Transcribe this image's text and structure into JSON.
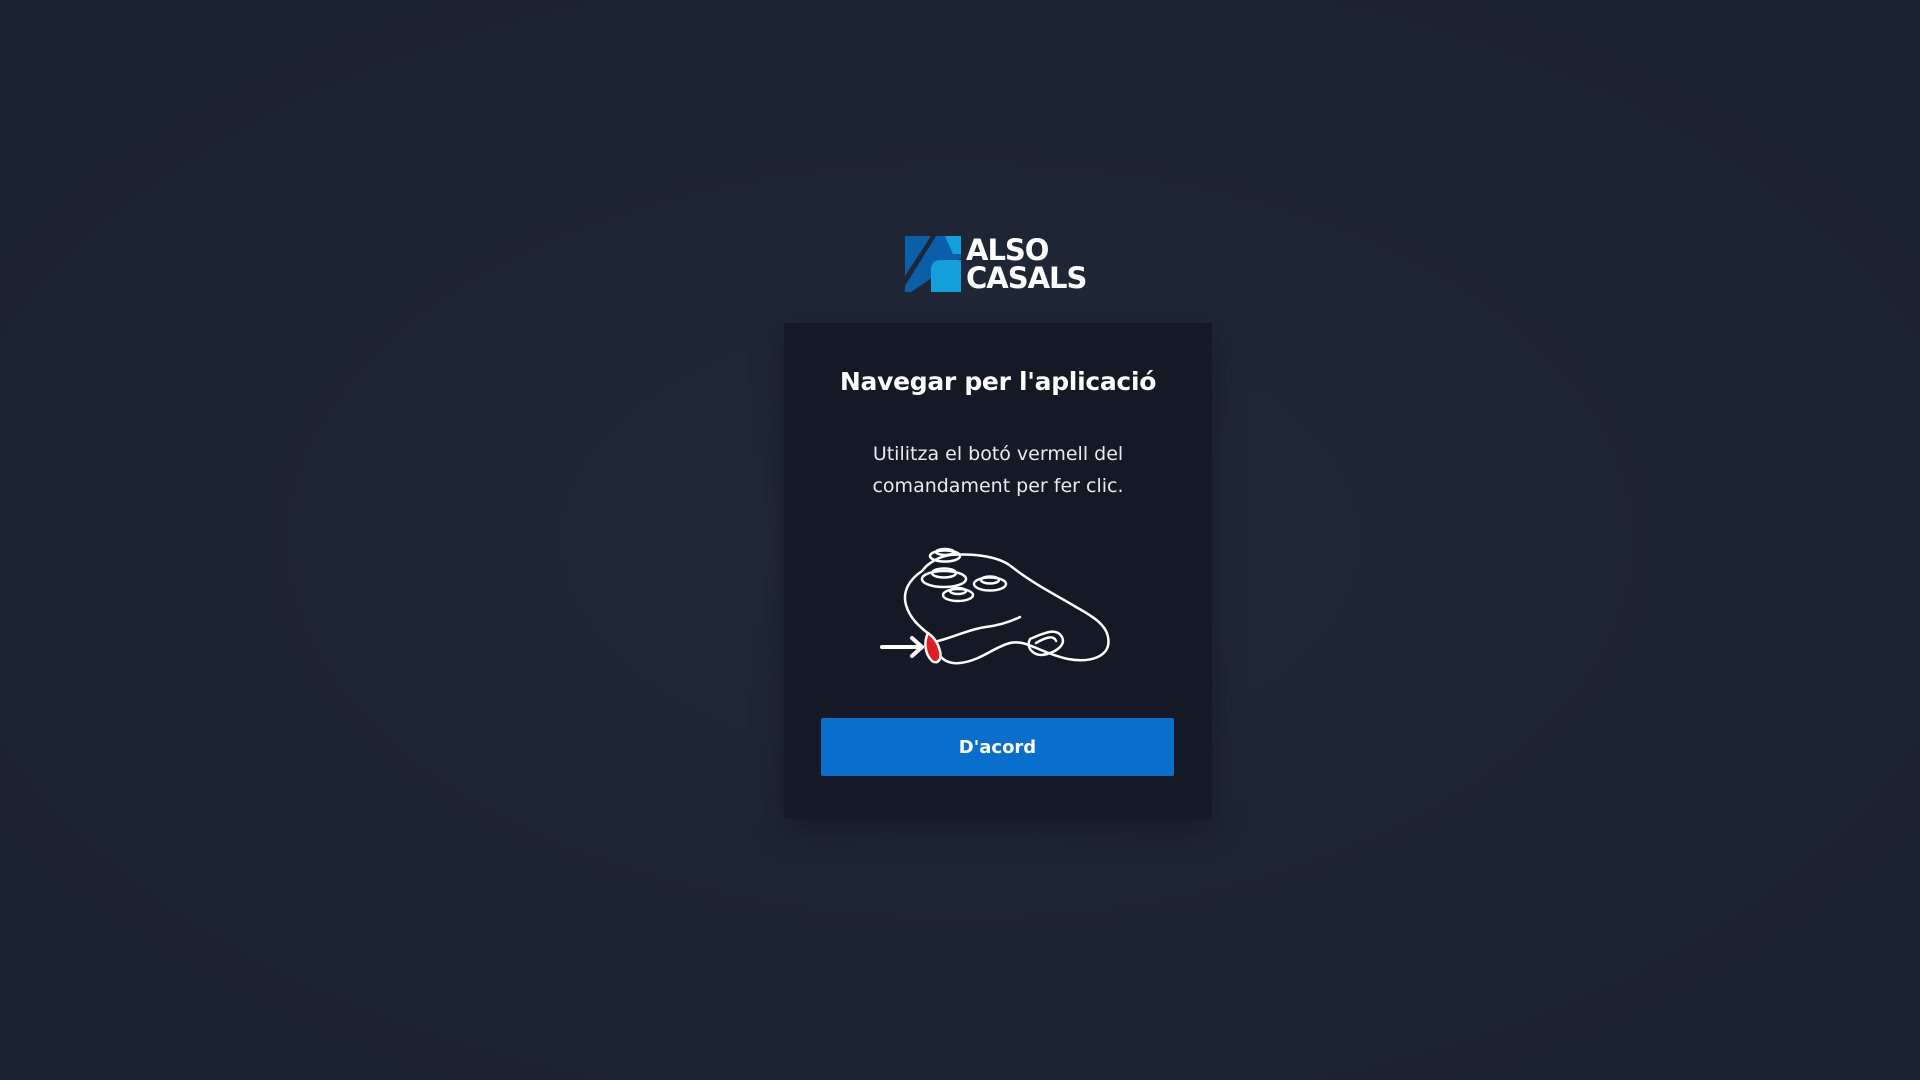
{
  "brand": {
    "line1": "ALSO",
    "line2": "CASALS",
    "colors": {
      "dark_blue": "#0b5fa8",
      "light_blue": "#12a0dc"
    }
  },
  "dialog": {
    "title": "Navegar per l'aplicació",
    "description_line1": "Utilitza el botó vermell del",
    "description_line2": "comandament per fer clic.",
    "illustration": "controller-trigger-icon",
    "ok_label": "D'acord",
    "accent_color": "#0a6fcc",
    "highlight_color": "#e31b23"
  }
}
